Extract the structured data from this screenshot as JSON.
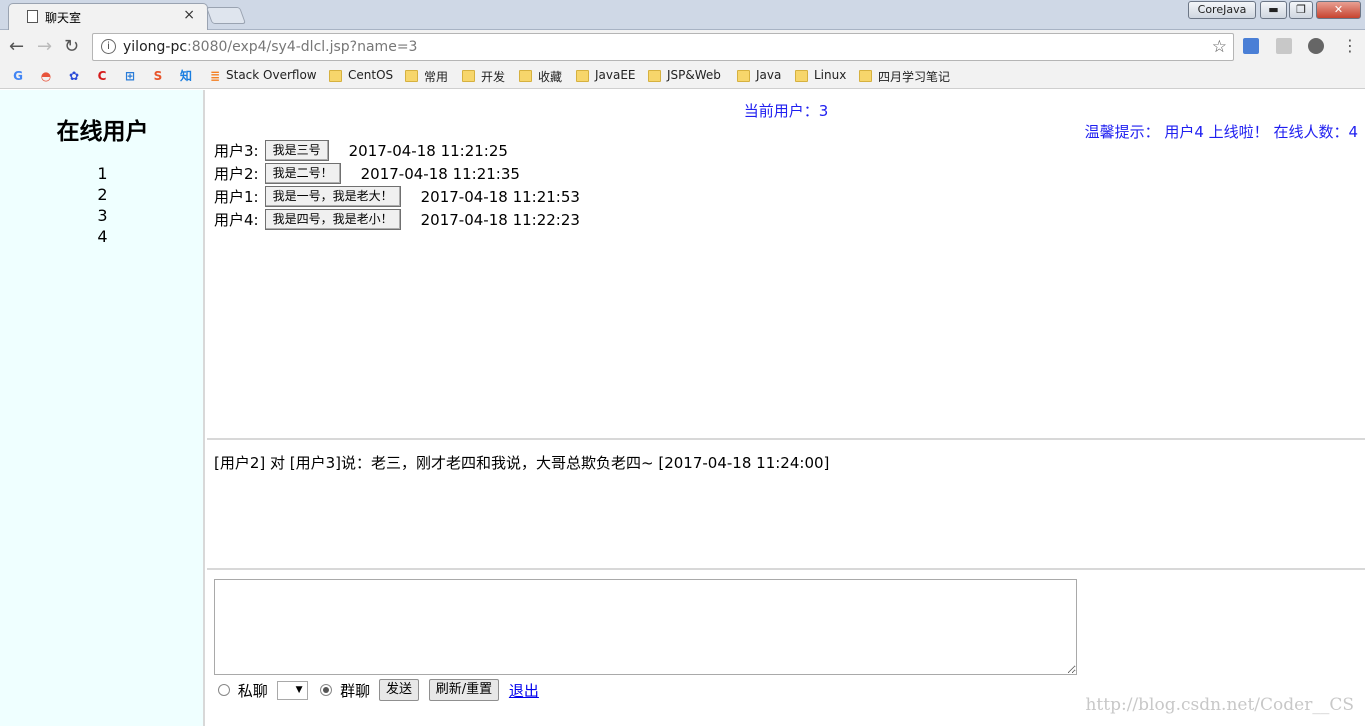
{
  "browser": {
    "tab_title": "聊天室",
    "tab_close": "×",
    "window_user": "CoreJava",
    "url_host": "yilong-pc",
    "url_path": ":8080/exp4/sy4-dlcl.jsp?name=3",
    "bookmarks": [
      {
        "label": "",
        "icon": "google-icon",
        "glyph": "G",
        "color": "#4285f4"
      },
      {
        "label": "",
        "icon": "rainbow-icon",
        "glyph": "◓",
        "color": "#e8543c"
      },
      {
        "label": "",
        "icon": "baidu-paw-icon",
        "glyph": "✿",
        "color": "#2b4bd8"
      },
      {
        "label": "",
        "icon": "csdn-c-icon",
        "glyph": "C",
        "color": "#d51b1b"
      },
      {
        "label": "",
        "icon": "grid-icon",
        "glyph": "⊞",
        "color": "#2a7cd8"
      },
      {
        "label": "",
        "icon": "sogou-s-icon",
        "glyph": "S",
        "color": "#e8542a"
      },
      {
        "label": "",
        "icon": "zhihu-icon",
        "glyph": "知",
        "color": "#1a7ee0"
      },
      {
        "label": "Stack Overflow",
        "icon": "stackoverflow-icon",
        "glyph": "≣",
        "color": "#f48024"
      },
      {
        "label": "CentOS",
        "icon": "folder-icon"
      },
      {
        "label": "常用",
        "icon": "folder-icon"
      },
      {
        "label": "开发",
        "icon": "folder-icon"
      },
      {
        "label": "收藏",
        "icon": "folder-icon"
      },
      {
        "label": "JavaEE",
        "icon": "folder-icon"
      },
      {
        "label": "JSP&Web",
        "icon": "folder-icon"
      },
      {
        "label": "Java",
        "icon": "folder-icon"
      },
      {
        "label": "Linux",
        "icon": "folder-icon"
      },
      {
        "label": "四月学习笔记",
        "icon": "folder-icon"
      }
    ]
  },
  "sidebar": {
    "title": "在线用户",
    "users": [
      "1",
      "2",
      "3",
      "4"
    ]
  },
  "messages_panel": {
    "current_user": "当前用户：3",
    "notice": "温馨提示： 用户4 上线啦！  在线人数：4",
    "messages": [
      {
        "sender": "用户3:",
        "text": "我是三号",
        "time": "2017-04-18 11:21:25"
      },
      {
        "sender": "用户2:",
        "text": "我是二号！",
        "time": "2017-04-18 11:21:35"
      },
      {
        "sender": "用户1:",
        "text": "我是一号，我是老大！",
        "time": "2017-04-18 11:21:53"
      },
      {
        "sender": "用户4:",
        "text": "我是四号，我是老小！",
        "time": "2017-04-18 11:22:23"
      }
    ]
  },
  "private_panel": {
    "text": "[用户2] 对 [用户3]说：老三，刚才老四和我说，大哥总欺负老四~   [2017-04-18 11:24:00]"
  },
  "input_panel": {
    "textarea_value": "",
    "private_label": "私聊",
    "select_value": "",
    "group_label": "群聊",
    "send_label": "发送",
    "refresh_label": "刷新/重置",
    "logout_label": "退出"
  },
  "watermark": "http://blog.csdn.net/Coder__CS",
  "colors": {
    "sidebar_bg": "#efffff",
    "accent_blue": "#1f1ff0",
    "link": "#0000ee"
  }
}
